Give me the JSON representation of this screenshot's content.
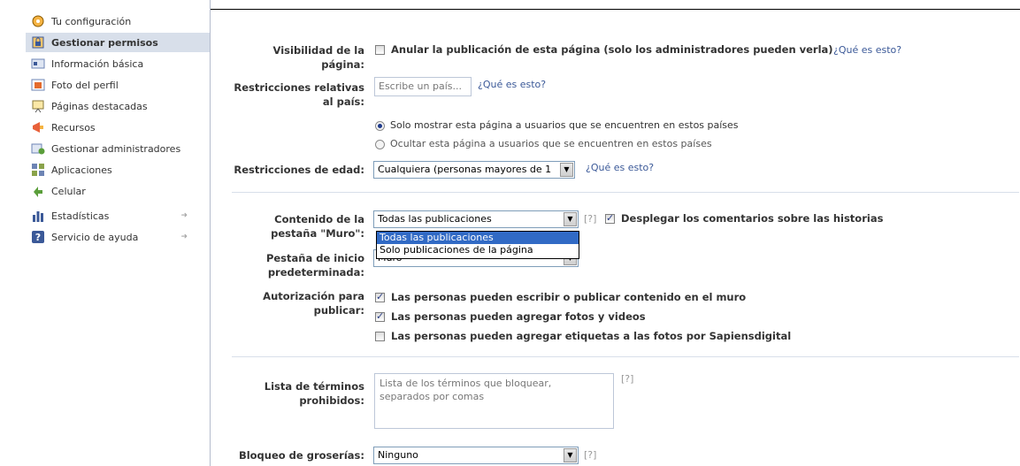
{
  "sidebar": {
    "items": [
      {
        "label": "Tu configuración",
        "icon": "settings-icon"
      },
      {
        "label": "Gestionar permisos",
        "icon": "lock-icon",
        "active": true
      },
      {
        "label": "Información básica",
        "icon": "info-card-icon"
      },
      {
        "label": "Foto del perfil",
        "icon": "photo-icon"
      },
      {
        "label": "Páginas destacadas",
        "icon": "featured-pages-icon"
      },
      {
        "label": "Recursos",
        "icon": "megaphone-icon"
      },
      {
        "label": "Gestionar administradores",
        "icon": "admin-icon"
      },
      {
        "label": "Aplicaciones",
        "icon": "apps-icon"
      },
      {
        "label": "Celular",
        "icon": "mobile-icon"
      },
      {
        "label": "Estadísticas",
        "icon": "stats-icon",
        "arrow": "➜"
      },
      {
        "label": "Servicio de ayuda",
        "icon": "help-icon",
        "arrow": "➜"
      }
    ]
  },
  "visibility": {
    "label": "Visibilidad de la página:",
    "checkbox_text": "Anular la publicación de esta página (solo los administradores pueden verla)",
    "checked": false,
    "help_link": "¿Qué es esto?"
  },
  "country": {
    "label": "Restricciones relativas al país:",
    "placeholder": "Escribe un país...",
    "help_link": "¿Qué es esto?",
    "radio_show": "Solo mostrar esta página a usuarios que se encuentren en estos países",
    "radio_hide": "Ocultar esta página a usuarios que se encuentren en estos países"
  },
  "age": {
    "label": "Restricciones de edad:",
    "value": "Cualquiera (personas mayores de 1",
    "help_link": "¿Qué es esto?"
  },
  "wall": {
    "label": "Contenido de la pestaña \"Muro\":",
    "value": "Todas las publicaciones",
    "help": "[?]",
    "comments_text": "Desplegar los comentarios sobre las historias",
    "comments_checked": true,
    "options": [
      "Todas las publicaciones",
      "Solo publicaciones de la página"
    ]
  },
  "default_tab": {
    "label": "Pestaña de inicio predeterminada:",
    "value": "Muro"
  },
  "posting": {
    "label": "Autorización para publicar:",
    "options": [
      {
        "text": "Las personas pueden escribir o publicar contenido en el muro",
        "checked": true
      },
      {
        "text": "Las personas pueden agregar fotos y videos",
        "checked": true
      },
      {
        "text": "Las personas pueden agregar etiquetas a las fotos por Sapiensdigital",
        "checked": false
      }
    ]
  },
  "blocklist": {
    "label": "Lista de términos prohibidos:",
    "placeholder": "Lista de los términos que bloquear,\nseparados por comas",
    "help": "[?]"
  },
  "profanity": {
    "label": "Bloqueo de groserías:",
    "value": "Ninguno",
    "help": "[?]"
  },
  "colors": {
    "link": "#3b5998",
    "active_bg": "#d8dfea",
    "dropdown_highlight": "#316ac5"
  }
}
